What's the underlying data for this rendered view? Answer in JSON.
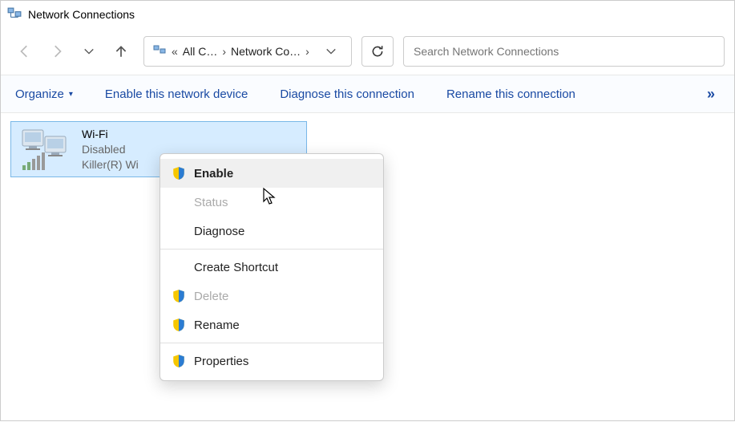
{
  "title": "Network Connections",
  "breadcrumb": {
    "root": "All C…",
    "current": "Network Co…"
  },
  "search_placeholder": "Search Network Connections",
  "commands": {
    "organize": "Organize",
    "enable": "Enable this network device",
    "diagnose": "Diagnose this connection",
    "rename": "Rename this connection",
    "overflow": "»"
  },
  "adapter": {
    "name": "Wi-Fi",
    "status": "Disabled",
    "driver": "Killer(R) Wi"
  },
  "context_menu": {
    "enable": "Enable",
    "status": "Status",
    "diagnose": "Diagnose",
    "create_shortcut": "Create Shortcut",
    "delete": "Delete",
    "rename": "Rename",
    "properties": "Properties"
  }
}
